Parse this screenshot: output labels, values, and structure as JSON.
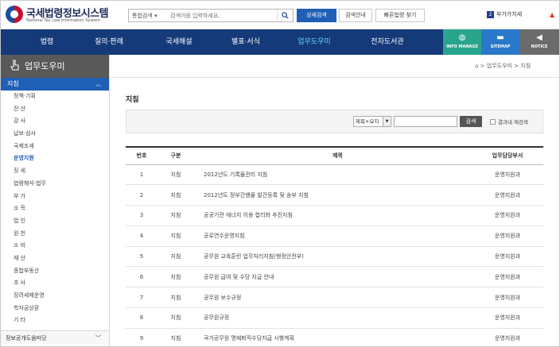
{
  "header": {
    "logo_title": "국세법령정보시스템",
    "logo_sub": "National Tax Law Information System",
    "search_scope": "통합검색 ▾",
    "search_placeholder": "검색어를 입력하세요.",
    "btn_detail": "상세검색",
    "btn_guide": "검색안내",
    "btn_quick": "빠른법령 찾기",
    "biz_num": "2",
    "biz_label": "부가가치세"
  },
  "nav": {
    "items": [
      "법령",
      "질의·판례",
      "국세해설",
      "별표·서식",
      "업무도우미",
      "전자도서관"
    ],
    "tools": [
      "INFO MANAGE",
      "SITEMAP",
      "NOTICE"
    ]
  },
  "sidebar": {
    "title": "업무도우미",
    "category": "지침",
    "items": [
      "정책·기획",
      "전 산",
      "감 사",
      "납보·심사",
      "국제조세",
      "운영지원",
      "징 세",
      "법령해석·법무",
      "부 가",
      "소 득",
      "법 인",
      "원 천",
      "소 비",
      "재 산",
      "종합부동산",
      "조 사",
      "장려세제운영",
      "학자금상환",
      "기 타"
    ],
    "active_item": "운영지원",
    "bottom": "정보공개도움마당"
  },
  "breadcrumb": "⌂ > 업무도우미 > 지침",
  "page_title": "지침",
  "filter": {
    "select_value": "제목+요지",
    "search_btn": "검색",
    "check_label": "결과내 재검색"
  },
  "table": {
    "headers": [
      "번호",
      "구분",
      "제목",
      "업무담당부서"
    ],
    "rows": [
      {
        "no": "1",
        "type": "지침",
        "title": "2012년도 기록물관리 지침",
        "dept": "운영지원과"
      },
      {
        "no": "2",
        "type": "지침",
        "title": "2012년도 정부간행물 발간등록 및 송부 지침",
        "dept": "운영지원과"
      },
      {
        "no": "3",
        "type": "지침",
        "title": "공공기관 에너지 이용 합리화 추진지침",
        "dept": "운영지원과"
      },
      {
        "no": "4",
        "type": "지침",
        "title": "공로연수운영지침",
        "dept": "운영지원과"
      },
      {
        "no": "5",
        "type": "지침",
        "title": "공무원 교육훈련 업무처리지침(행정안전부)",
        "dept": "운영지원과"
      },
      {
        "no": "6",
        "type": "지침",
        "title": "공무원 급여 및 수당 지급 안내",
        "dept": "운영지원과"
      },
      {
        "no": "7",
        "type": "지침",
        "title": "공무원 보수규정",
        "dept": "운영지원과"
      },
      {
        "no": "8",
        "type": "지침",
        "title": "공무원규정",
        "dept": "운영지원과"
      },
      {
        "no": "9",
        "type": "지침",
        "title": "국가공무원 명예퇴직수당지급 시행계획",
        "dept": "운영지원과"
      }
    ]
  }
}
